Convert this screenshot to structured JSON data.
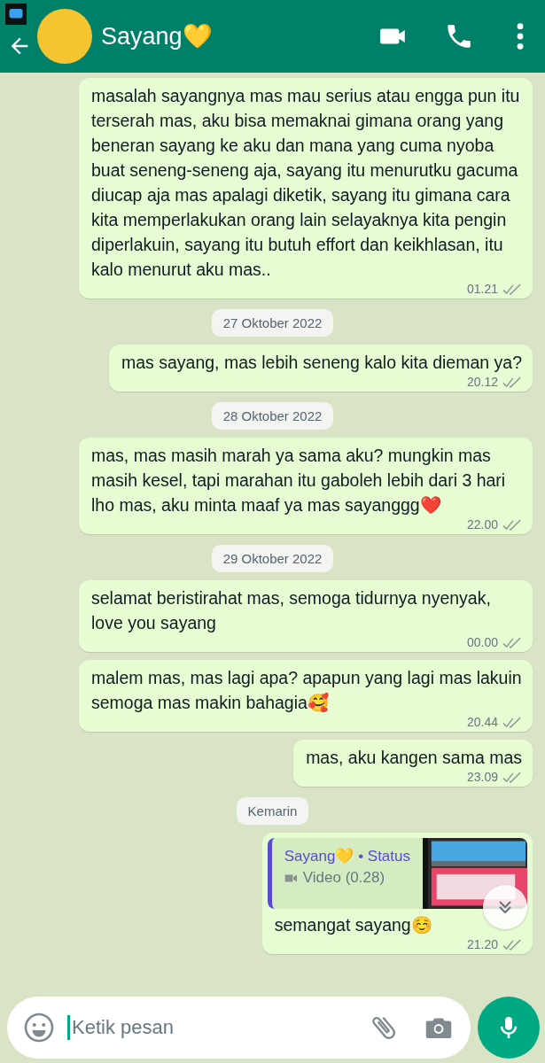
{
  "header": {
    "contact_name": "Sayang💛"
  },
  "messages": [
    {
      "kind": "text",
      "text": "masalah sayangnya mas mau serius atau engga pun itu terserah mas, aku bisa memaknai gimana orang yang beneran sayang ke aku dan mana yang cuma nyoba buat seneng-seneng aja, sayang itu menurutku gacuma diucap aja mas apalagi diketik, sayang itu gimana cara kita memperlakukan orang lain selayaknya kita pengin diperlakuin, sayang itu butuh effort dan keikhlasan, itu kalo menurut aku mas..",
      "time": "01.21",
      "read": false
    },
    {
      "kind": "date",
      "text": "27 Oktober 2022"
    },
    {
      "kind": "text",
      "text": "mas sayang, mas lebih seneng kalo kita dieman ya?",
      "time": "20.12",
      "read": false
    },
    {
      "kind": "date",
      "text": "28 Oktober 2022"
    },
    {
      "kind": "text",
      "text": "mas, mas masih marah ya sama aku? mungkin mas masih kesel, tapi marahan itu gaboleh lebih dari 3 hari lho mas, aku minta maaf ya mas sayanggg❤️",
      "time": "22.00",
      "read": false
    },
    {
      "kind": "date",
      "text": "29 Oktober 2022"
    },
    {
      "kind": "text",
      "text": "selamat beristirahat mas, semoga tidurnya nyenyak, love you sayang",
      "time": "00.00",
      "read": false
    },
    {
      "kind": "text",
      "text": "malem mas, mas lagi apa? apapun yang lagi mas lakuin semoga mas makin bahagia🥰",
      "time": "20.44",
      "read": false
    },
    {
      "kind": "text",
      "text": "mas, aku kangen sama mas",
      "time": "23.09",
      "read": false
    },
    {
      "kind": "date",
      "text": "Kemarin"
    },
    {
      "kind": "reply",
      "quote_author": "Sayang💛 • Status",
      "quote_text": "Video (0.28)",
      "text": "semangat sayang☺️",
      "time": "21.20",
      "read": false
    }
  ],
  "composer": {
    "placeholder": "Ketik pesan"
  }
}
